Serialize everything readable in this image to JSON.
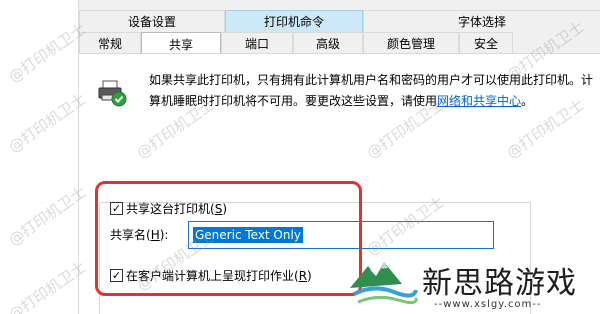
{
  "tabs_top": [
    "设备设置",
    "打印机命令",
    "字体选择"
  ],
  "tabs_bottom": [
    "常规",
    "共享",
    "端口",
    "高级",
    "颜色管理",
    "安全"
  ],
  "intro": {
    "text": "如果共享此打印机，只有拥有此计算机用户名和密码的用户才可以使用此打印机。计算机睡眠时打印机将不可用。要更改这些设置，请使用",
    "link": "网络和共享中心",
    "end": "。"
  },
  "share_checkbox": {
    "label": "共享这台打印机",
    "accel": "S",
    "checked": true
  },
  "share_name": {
    "label": "共享名",
    "accel": "H",
    "value": "Generic  Text Only"
  },
  "render_checkbox": {
    "label": "在客户端计算机上呈现打印作业",
    "accel": "R",
    "checked": true
  },
  "watermark": "@打印机卫士",
  "brand": {
    "name": "新思路游戏",
    "url": "--www.xslgy.com--"
  },
  "colors": {
    "highlight_tab": "#cde8f7",
    "selection": "#0078d7",
    "annotation_box": "#e2342c",
    "link": "#0066cc"
  }
}
